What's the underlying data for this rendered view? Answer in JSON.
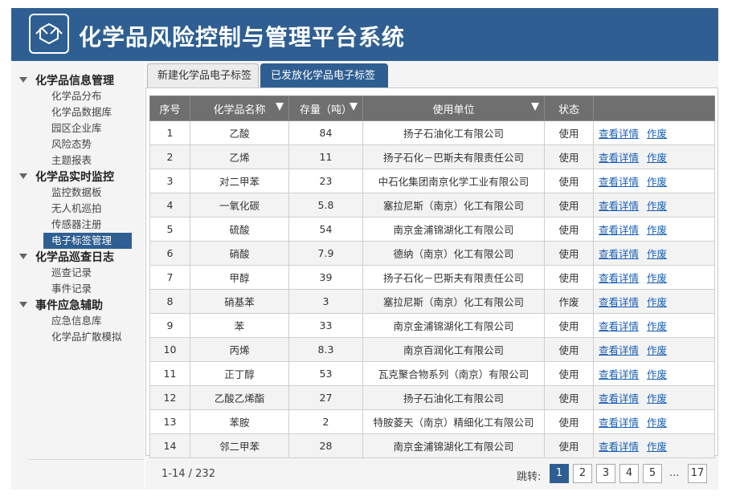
{
  "header": {
    "title": "化学品风险控制与管理平台系统"
  },
  "sidebar": {
    "groups": [
      {
        "title": "化学品信息管理",
        "items": [
          "化学品分布",
          "化学品数据库",
          "园区企业库",
          "风险态势",
          "主题报表"
        ]
      },
      {
        "title": "化学品实时监控",
        "items": [
          "监控数据板",
          "无人机巡拍",
          "传感器注册",
          "电子标签管理"
        ]
      },
      {
        "title": "化学品巡查日志",
        "items": [
          "巡查记录",
          "事件记录"
        ]
      },
      {
        "title": "事件应急辅助",
        "items": [
          "应急信息库",
          "化学品扩散模拟"
        ]
      }
    ],
    "active_item": "电子标签管理"
  },
  "tabs": [
    "新建化学品电子标签",
    "已发放化学品电子标签"
  ],
  "active_tab": 1,
  "table": {
    "columns": [
      "序号",
      "化学品名称",
      "存量（吨）",
      "使用单位",
      "状态",
      ""
    ],
    "rows": [
      [
        "1",
        "乙酸",
        "84",
        "扬子石油化工有限公司",
        "使用"
      ],
      [
        "2",
        "乙烯",
        "11",
        "扬子石化－巴斯夫有限责任公司",
        "使用"
      ],
      [
        "3",
        "对二甲苯",
        "23",
        "中石化集团南京化学工业有限公司",
        "使用"
      ],
      [
        "4",
        "一氧化碳",
        "5.8",
        "塞拉尼斯（南京）化工有限公司",
        "使用"
      ],
      [
        "5",
        "硫酸",
        "54",
        "南京金浦锦湖化工有限公司",
        "使用"
      ],
      [
        "6",
        "硝酸",
        "7.9",
        "德纳（南京）化工有限公司",
        "使用"
      ],
      [
        "7",
        "甲醇",
        "39",
        "扬子石化－巴斯夫有限责任公司",
        "使用"
      ],
      [
        "8",
        "硝基苯",
        "3",
        "塞拉尼斯（南京）化工有限公司",
        "作废"
      ],
      [
        "9",
        "苯",
        "33",
        "南京金浦锦湖化工有限公司",
        "使用"
      ],
      [
        "10",
        "丙烯",
        "8.3",
        "南京百润化工有限公司",
        "使用"
      ],
      [
        "11",
        "正丁醇",
        "53",
        "瓦克聚合物系列（南京）有限公司",
        "使用"
      ],
      [
        "12",
        "乙酸乙烯酯",
        "27",
        "扬子石油化工有限公司",
        "使用"
      ],
      [
        "13",
        "苯胺",
        "2",
        "特胺菱天（南京）精细化工有限公司",
        "使用"
      ],
      [
        "14",
        "邻二甲苯",
        "28",
        "南京金浦锦湖化工有限公司",
        "使用"
      ]
    ],
    "action_labels": {
      "view": "查看详情",
      "void": "作废"
    }
  },
  "pagination": {
    "info": "1-14 / 232",
    "jump_label": "跳转:",
    "pages": [
      "1",
      "2",
      "3",
      "4",
      "5"
    ],
    "ellipsis": "...",
    "last_page": "17",
    "current": "1"
  },
  "colors": {
    "primary": "#2f5f92",
    "table_header": "#6f6f6f",
    "link": "#1a5fb4"
  }
}
